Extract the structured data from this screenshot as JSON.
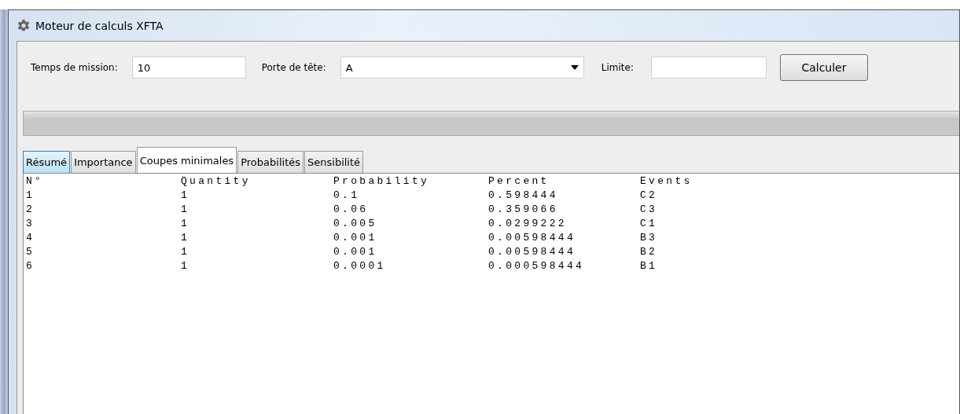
{
  "window": {
    "title": "Moteur de calculs XFTA"
  },
  "form": {
    "mission_label": "Temps de mission:",
    "mission_value": "10",
    "gate_label": "Porte de tête:",
    "gate_value": "A",
    "limit_label": "Limite:",
    "button": "Calculer"
  },
  "progress": {
    "level": 0
  },
  "tabs": [
    {
      "label": "Résumé",
      "selected": false,
      "highlighted": true
    },
    {
      "label": "Importance",
      "selected": false,
      "highlighted": false
    },
    {
      "label": "Coupes minimales",
      "selected": true,
      "highlighted": false
    },
    {
      "label": "Probabilités",
      "selected": false,
      "highlighted": false
    },
    {
      "label": "Sensibilité",
      "selected": false,
      "highlighted": false
    }
  ],
  "table": {
    "columns": [
      "N°",
      "Quantity",
      "Probability",
      "Percent",
      "Events"
    ],
    "rows": [
      [
        "1",
        "1",
        "0.1",
        "0.598444",
        "C2"
      ],
      [
        "2",
        "1",
        "0.06",
        "0.359066",
        "C3"
      ],
      [
        "3",
        "1",
        "0.005",
        "0.0299222",
        "C1"
      ],
      [
        "4",
        "1",
        "0.001",
        "0.00598444",
        "B3"
      ],
      [
        "5",
        "1",
        "0.001",
        "0.00598444",
        "B2"
      ],
      [
        "6",
        "1",
        "0.0001",
        "0.000598444",
        "B1"
      ]
    ]
  }
}
